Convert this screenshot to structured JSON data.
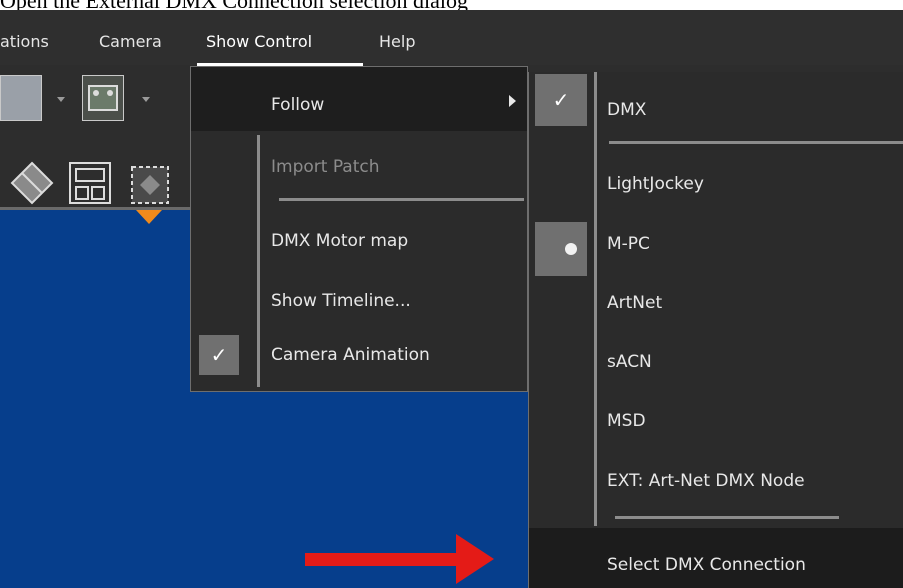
{
  "caption": "Open the External DMX Connection selection dialog",
  "menubar": {
    "items": [
      {
        "label": "ations"
      },
      {
        "label": "Camera"
      },
      {
        "label": "Show Control"
      },
      {
        "label": "Help"
      }
    ]
  },
  "show_control_menu": {
    "items": [
      {
        "label": "Follow",
        "checked": false,
        "has_submenu": true,
        "highlighted": true
      },
      {
        "label": "Import Patch",
        "disabled": true
      },
      {
        "label": "DMX Motor map"
      },
      {
        "label": "Show Timeline..."
      },
      {
        "label": "Camera Animation",
        "checked": true,
        "check_glyph": "✓"
      }
    ]
  },
  "follow_submenu": {
    "items": [
      {
        "label": "DMX",
        "checked": true,
        "check_glyph": "✓"
      },
      {
        "label": "LightJockey"
      },
      {
        "label": "M-PC",
        "selected_bullet": true
      },
      {
        "label": "ArtNet"
      },
      {
        "label": "sACN"
      },
      {
        "label": "MSD"
      },
      {
        "label": "EXT: Art-Net DMX Node"
      },
      {
        "label": "Select DMX Connection",
        "highlighted": true
      }
    ]
  },
  "colors": {
    "viewport": "#063e8c",
    "menu_bg": "#2b2b2b",
    "highlight": "#1e1e1e",
    "annotation_arrow": "#e41b17",
    "marker": "#f08a1c"
  },
  "icons": [
    "display-icon",
    "stage-scene-icon",
    "layout-diamond-icon",
    "layout-grid-icon",
    "layout-dashed-icon",
    "chevron-right-icon",
    "check-icon",
    "radio-bullet-icon",
    "red-arrow-annotation"
  ]
}
